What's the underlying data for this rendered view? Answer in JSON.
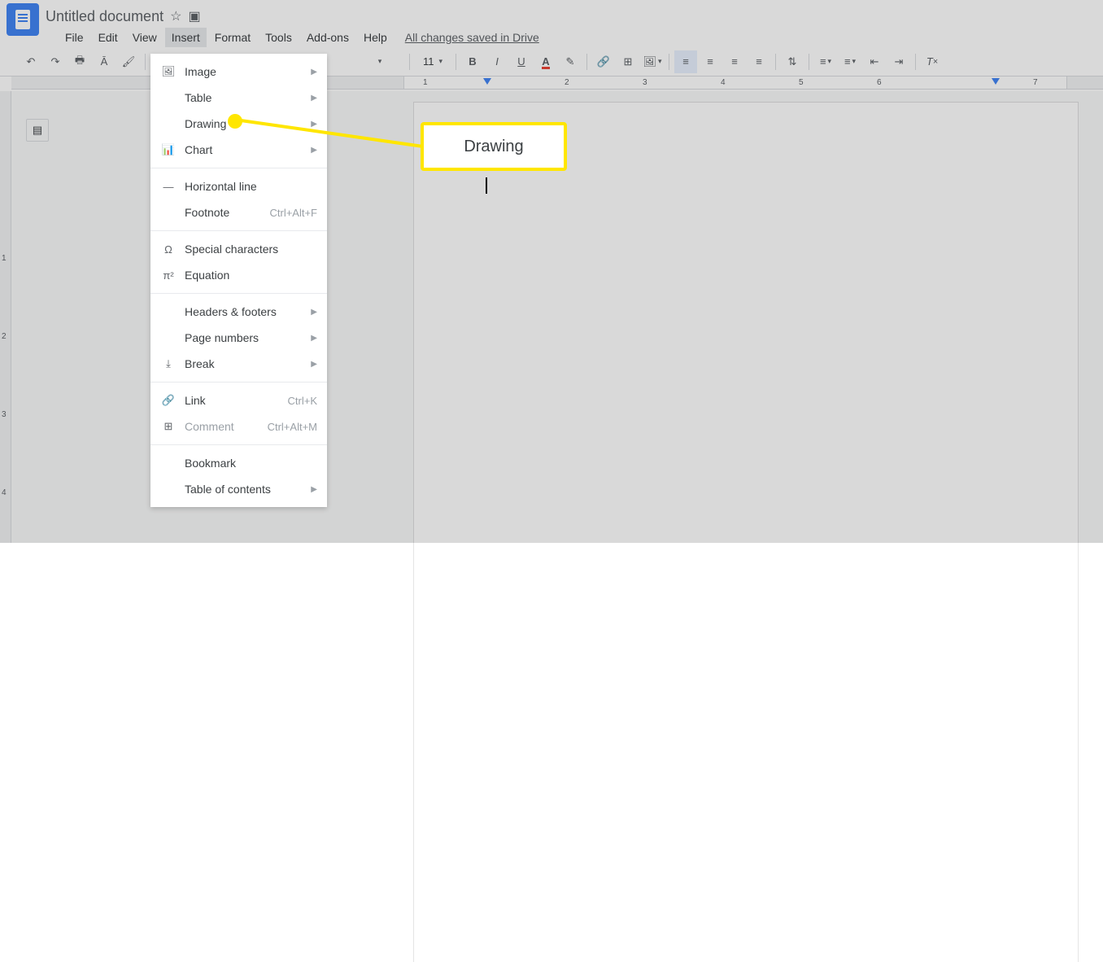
{
  "doc_title": "Untitled document",
  "menubar": [
    "File",
    "Edit",
    "View",
    "Insert",
    "Format",
    "Tools",
    "Add-ons",
    "Help"
  ],
  "save_status": "All changes saved in Drive",
  "font_size": "11",
  "insert_menu": {
    "items": [
      {
        "icon": "image",
        "label": "Image",
        "submenu": true
      },
      {
        "icon": "",
        "label": "Table",
        "submenu": true
      },
      {
        "icon": "",
        "label": "Drawing",
        "submenu": true
      },
      {
        "icon": "chart",
        "label": "Chart",
        "submenu": true
      },
      {
        "divider": true
      },
      {
        "icon": "line",
        "label": "Horizontal line"
      },
      {
        "icon": "",
        "label": "Footnote",
        "shortcut": "Ctrl+Alt+F"
      },
      {
        "divider": true
      },
      {
        "icon": "omega",
        "label": "Special characters"
      },
      {
        "icon": "pi",
        "label": "Equation"
      },
      {
        "divider": true
      },
      {
        "icon": "",
        "label": "Headers & footers",
        "submenu": true
      },
      {
        "icon": "",
        "label": "Page numbers",
        "submenu": true
      },
      {
        "icon": "break",
        "label": "Break",
        "submenu": true
      },
      {
        "divider": true
      },
      {
        "icon": "link",
        "label": "Link",
        "shortcut": "Ctrl+K"
      },
      {
        "icon": "comment",
        "label": "Comment",
        "shortcut": "Ctrl+Alt+M",
        "disabled": true
      },
      {
        "divider": true
      },
      {
        "icon": "",
        "label": "Bookmark"
      },
      {
        "icon": "",
        "label": "Table of contents",
        "submenu": true
      }
    ]
  },
  "callout_label": "Drawing",
  "ruler_numbers": [
    "1",
    "2",
    "3",
    "4",
    "5",
    "6",
    "7"
  ],
  "vruler_numbers": [
    "1",
    "2",
    "3",
    "4"
  ]
}
